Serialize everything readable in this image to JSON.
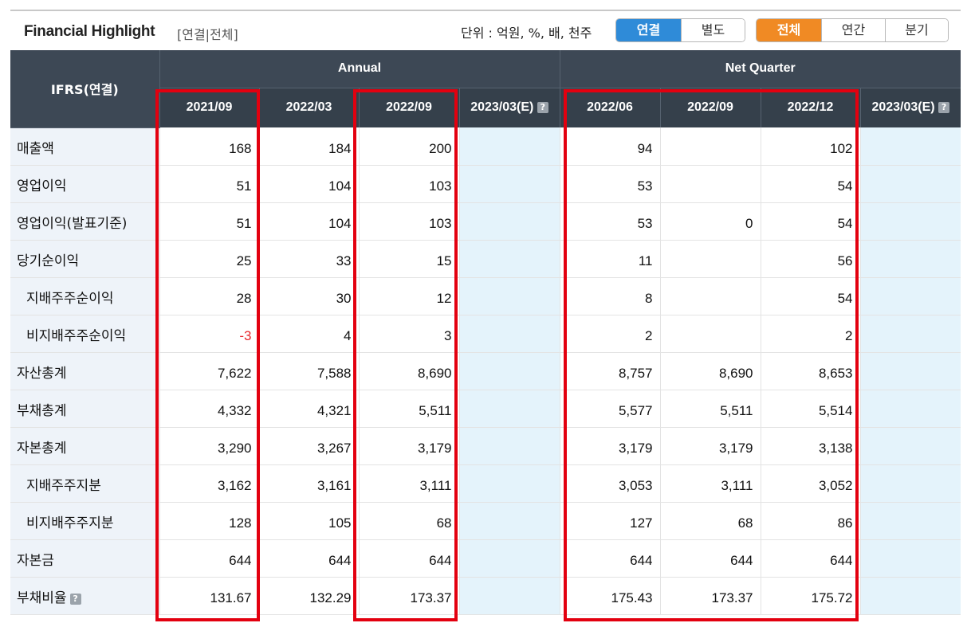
{
  "header": {
    "title": "Financial Highlight",
    "subtitle": "[연결|전체]",
    "unit_label": "단위 : 억원, %, 배, 천주"
  },
  "toggle_consolidation": [
    "연결",
    "별도"
  ],
  "toggle_period": [
    "전체",
    "연간",
    "분기"
  ],
  "colors": {
    "header_bg": "#3d4855",
    "active_blue": "#2f8bd8",
    "active_orange": "#f08a24",
    "highlight_box": "#e3000f",
    "negative": "#e8262b"
  },
  "table": {
    "row_header": "IFRS(연결)",
    "groups": [
      "Annual",
      "Net Quarter"
    ],
    "columns": [
      "2021/09",
      "2022/03",
      "2022/09",
      "2023/03(E)",
      "2022/06",
      "2022/09",
      "2022/12",
      "2023/03(E)"
    ],
    "rows": [
      {
        "label": "매출액",
        "values": [
          "168",
          "184",
          "200",
          "",
          "94",
          "",
          "102",
          ""
        ]
      },
      {
        "label": "영업이익",
        "values": [
          "51",
          "104",
          "103",
          "",
          "53",
          "",
          "54",
          ""
        ]
      },
      {
        "label": "영업이익(발표기준)",
        "values": [
          "51",
          "104",
          "103",
          "",
          "53",
          "0",
          "54",
          ""
        ]
      },
      {
        "label": "당기순이익",
        "values": [
          "25",
          "33",
          "15",
          "",
          "11",
          "",
          "56",
          ""
        ]
      },
      {
        "label": "지배주주순이익",
        "values": [
          "28",
          "30",
          "12",
          "",
          "8",
          "",
          "54",
          ""
        ]
      },
      {
        "label": "비지배주주순이익",
        "values": [
          "-3",
          "4",
          "3",
          "",
          "2",
          "",
          "2",
          ""
        ]
      },
      {
        "label": "자산총계",
        "values": [
          "7,622",
          "7,588",
          "8,690",
          "",
          "8,757",
          "8,690",
          "8,653",
          ""
        ]
      },
      {
        "label": "부채총계",
        "values": [
          "4,332",
          "4,321",
          "5,511",
          "",
          "5,577",
          "5,511",
          "5,514",
          ""
        ]
      },
      {
        "label": "자본총계",
        "values": [
          "3,290",
          "3,267",
          "3,179",
          "",
          "3,179",
          "3,179",
          "3,138",
          ""
        ]
      },
      {
        "label": "지배주주지분",
        "values": [
          "3,162",
          "3,161",
          "3,111",
          "",
          "3,053",
          "3,111",
          "3,052",
          ""
        ]
      },
      {
        "label": "비지배주주지분",
        "values": [
          "128",
          "105",
          "68",
          "",
          "127",
          "68",
          "86",
          ""
        ]
      },
      {
        "label": "자본금",
        "values": [
          "644",
          "644",
          "644",
          "",
          "644",
          "644",
          "644",
          ""
        ]
      },
      {
        "label": "부채비율",
        "values": [
          "131.67",
          "132.29",
          "173.37",
          "",
          "175.43",
          "173.37",
          "175.72",
          ""
        ]
      }
    ]
  },
  "help_icon_glyph": "?"
}
